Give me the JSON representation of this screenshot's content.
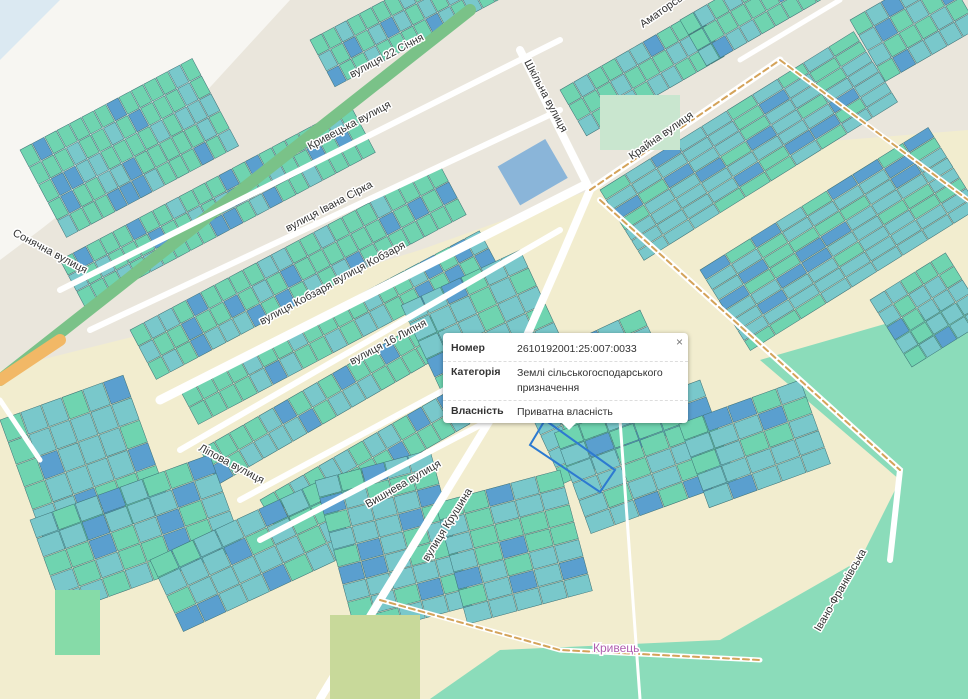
{
  "streets": {
    "kryvetska": "Кривецька вулиця",
    "may22": "вулиця 22 Січня",
    "ivana_sirka": "вулиця Івана Сірка",
    "kobzarya_1": "вулиця Кобзаря",
    "kobzarya_2": "вулиця Кобзаря",
    "july16": "вулиця 16 Липня",
    "sonyachna": "Сонячна вулиця",
    "lypova": "Ліпова вулиця",
    "vyshneva": "Вишнева вулиця",
    "krushyna": "вулиця Крушина",
    "kraina": "Крайна вулиця",
    "amatorska": "Аматорська",
    "shkilna": "Шкільна вулиця",
    "ivano_frankivska": "Івано-Франківська"
  },
  "places": {
    "kryvets": "Кривець"
  },
  "popup": {
    "close": "×",
    "rows": [
      {
        "label": "Номер",
        "value": "2610192001:25:007:0033"
      },
      {
        "label": "Категорія",
        "value": "Землі сільськогосподарського призначення"
      },
      {
        "label": "Власність",
        "value": "Приватна власність"
      }
    ]
  },
  "colors": {
    "parcel_green": "#6fd4b0",
    "parcel_teal": "#79c8cb",
    "parcel_blue": "#5a9fcf",
    "road_main": "#7ac288",
    "road_orange": "#f2b866",
    "land_pale": "#f2edcf",
    "ground": "#eae6dc"
  }
}
